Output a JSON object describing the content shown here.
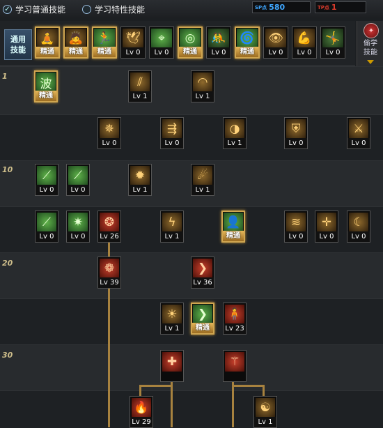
{
  "top_bar": {
    "learn_normal_skills": "学习普通技能",
    "learn_trait_skills": "学习特性技能",
    "counter_a": {
      "label": "SP点",
      "value": "580",
      "color": "#3fa7ff"
    },
    "counter_b": {
      "label": "TP点",
      "value": "1",
      "color": "#e03c2c"
    }
  },
  "general_skills": {
    "label_line1": "通用",
    "label_line2": "技能",
    "items": [
      {
        "icon": "meditate-icon",
        "glyph": "🧘",
        "level": "精通",
        "sealed": true,
        "tone": "y"
      },
      {
        "icon": "kneel-icon",
        "glyph": "🙇",
        "level": "精通",
        "sealed": true,
        "tone": "y"
      },
      {
        "icon": "dash-icon",
        "glyph": "🏃",
        "level": "精通",
        "sealed": true,
        "tone": "g"
      },
      {
        "icon": "wings-icon",
        "glyph": "🕊",
        "level": "Lv 0",
        "sealed": false,
        "tone": "y"
      },
      {
        "icon": "crosshair-icon",
        "glyph": "⌖",
        "level": "Lv 0",
        "sealed": false,
        "tone": "g"
      },
      {
        "icon": "target-icon",
        "glyph": "◎",
        "level": "精通",
        "sealed": true,
        "tone": "g"
      },
      {
        "icon": "tackle-icon",
        "glyph": "🤼",
        "level": "Lv 0",
        "sealed": false,
        "tone": "gb"
      },
      {
        "icon": "spin-icon",
        "glyph": "🌀",
        "level": "精通",
        "sealed": true,
        "tone": "g"
      },
      {
        "icon": "eye-icon",
        "glyph": "👁",
        "level": "Lv 0",
        "sealed": false,
        "tone": "y"
      },
      {
        "icon": "strength-icon",
        "glyph": "💪",
        "level": "Lv 0",
        "sealed": false,
        "tone": "y"
      },
      {
        "icon": "jump-icon",
        "glyph": "🤸",
        "level": "Lv 0",
        "sealed": false,
        "tone": "gb"
      }
    ]
  },
  "steal_skills": {
    "label_line1": "偷学",
    "label_line2": "技能"
  },
  "level_markers": [
    "1",
    "10",
    "20",
    "30"
  ],
  "skills": [
    {
      "name": "wave-icon",
      "glyph": "波",
      "level": "精通",
      "sealed": true,
      "tone": "g"
    },
    {
      "name": "claw-slash-icon",
      "glyph": "⫽",
      "level": "Lv 1",
      "sealed": false,
      "tone": "y"
    },
    {
      "name": "sweep-slash-icon",
      "glyph": "◠",
      "level": "Lv 1",
      "sealed": false,
      "tone": "y"
    },
    {
      "name": "eagle-icon",
      "glyph": "✵",
      "level": "Lv 0",
      "sealed": false,
      "tone": "y"
    },
    {
      "name": "multi-arrow-icon",
      "glyph": "⇶",
      "level": "Lv 0",
      "sealed": false,
      "tone": "y"
    },
    {
      "name": "vortex-icon",
      "glyph": "◑",
      "level": "Lv 1",
      "sealed": false,
      "tone": "y"
    },
    {
      "name": "shield-icon",
      "glyph": "⛨",
      "level": "Lv 0",
      "sealed": false,
      "tone": "y"
    },
    {
      "name": "triple-blade-icon",
      "glyph": "⚔",
      "level": "Lv 0",
      "sealed": false,
      "tone": "y"
    },
    {
      "name": "blade-thrust-icon",
      "glyph": "⟋",
      "level": "Lv 0",
      "sealed": false,
      "tone": "g"
    },
    {
      "name": "long-blade-icon",
      "glyph": "⟋",
      "level": "Lv 0",
      "sealed": false,
      "tone": "g"
    },
    {
      "name": "flame-burst-icon",
      "glyph": "✹",
      "level": "Lv 1",
      "sealed": false,
      "tone": "y"
    },
    {
      "name": "energy-ring-icon",
      "glyph": "☄",
      "level": "Lv 1",
      "sealed": false,
      "tone": "y"
    },
    {
      "name": "sword-strike-icon",
      "glyph": "⟋",
      "level": "Lv 0",
      "sealed": false,
      "tone": "g"
    },
    {
      "name": "spark-icon",
      "glyph": "✷",
      "level": "Lv 0",
      "sealed": false,
      "tone": "g"
    },
    {
      "name": "triple-orb-icon",
      "glyph": "❂",
      "level": "Lv 26",
      "sealed": false,
      "tone": "r"
    },
    {
      "name": "lightning-icon",
      "glyph": "ϟ",
      "level": "Lv 1",
      "sealed": false,
      "tone": "y"
    },
    {
      "name": "head-sparkle-icon",
      "glyph": "👤",
      "level": "精通",
      "sealed": true,
      "tone": "g"
    },
    {
      "name": "wind-slash-icon",
      "glyph": "≋",
      "level": "Lv 0",
      "sealed": false,
      "tone": "y"
    },
    {
      "name": "cross-spark-icon",
      "glyph": "✛",
      "level": "Lv 0",
      "sealed": false,
      "tone": "y"
    },
    {
      "name": "crescent-icon",
      "glyph": "☾",
      "level": "Lv 0",
      "sealed": false,
      "tone": "y"
    },
    {
      "name": "seal-orb-icon",
      "glyph": "❁",
      "level": "Lv 39",
      "sealed": false,
      "tone": "r"
    },
    {
      "name": "chevron-burst-icon",
      "glyph": "❯",
      "level": "Lv 36",
      "sealed": false,
      "tone": "r"
    },
    {
      "name": "sun-burst-icon",
      "glyph": "☀",
      "level": "Lv 1",
      "sealed": false,
      "tone": "y"
    },
    {
      "name": "chevron-flow-icon",
      "glyph": "❯",
      "level": "精通",
      "sealed": true,
      "tone": "g"
    },
    {
      "name": "warrior-icon",
      "glyph": "🧍",
      "level": "Lv 23",
      "sealed": false,
      "tone": "r"
    },
    {
      "name": "impact-cross-icon",
      "glyph": "✚",
      "level": "",
      "sealed": false,
      "tone": "r"
    },
    {
      "name": "blade-pillar-icon",
      "glyph": "⚚",
      "level": "",
      "sealed": false,
      "tone": "r"
    },
    {
      "name": "fire-icon",
      "glyph": "🔥",
      "level": "Lv 29",
      "sealed": false,
      "tone": "r"
    },
    {
      "name": "orbit-icon",
      "glyph": "☯",
      "level": "Lv 1",
      "sealed": false,
      "tone": "y"
    }
  ]
}
